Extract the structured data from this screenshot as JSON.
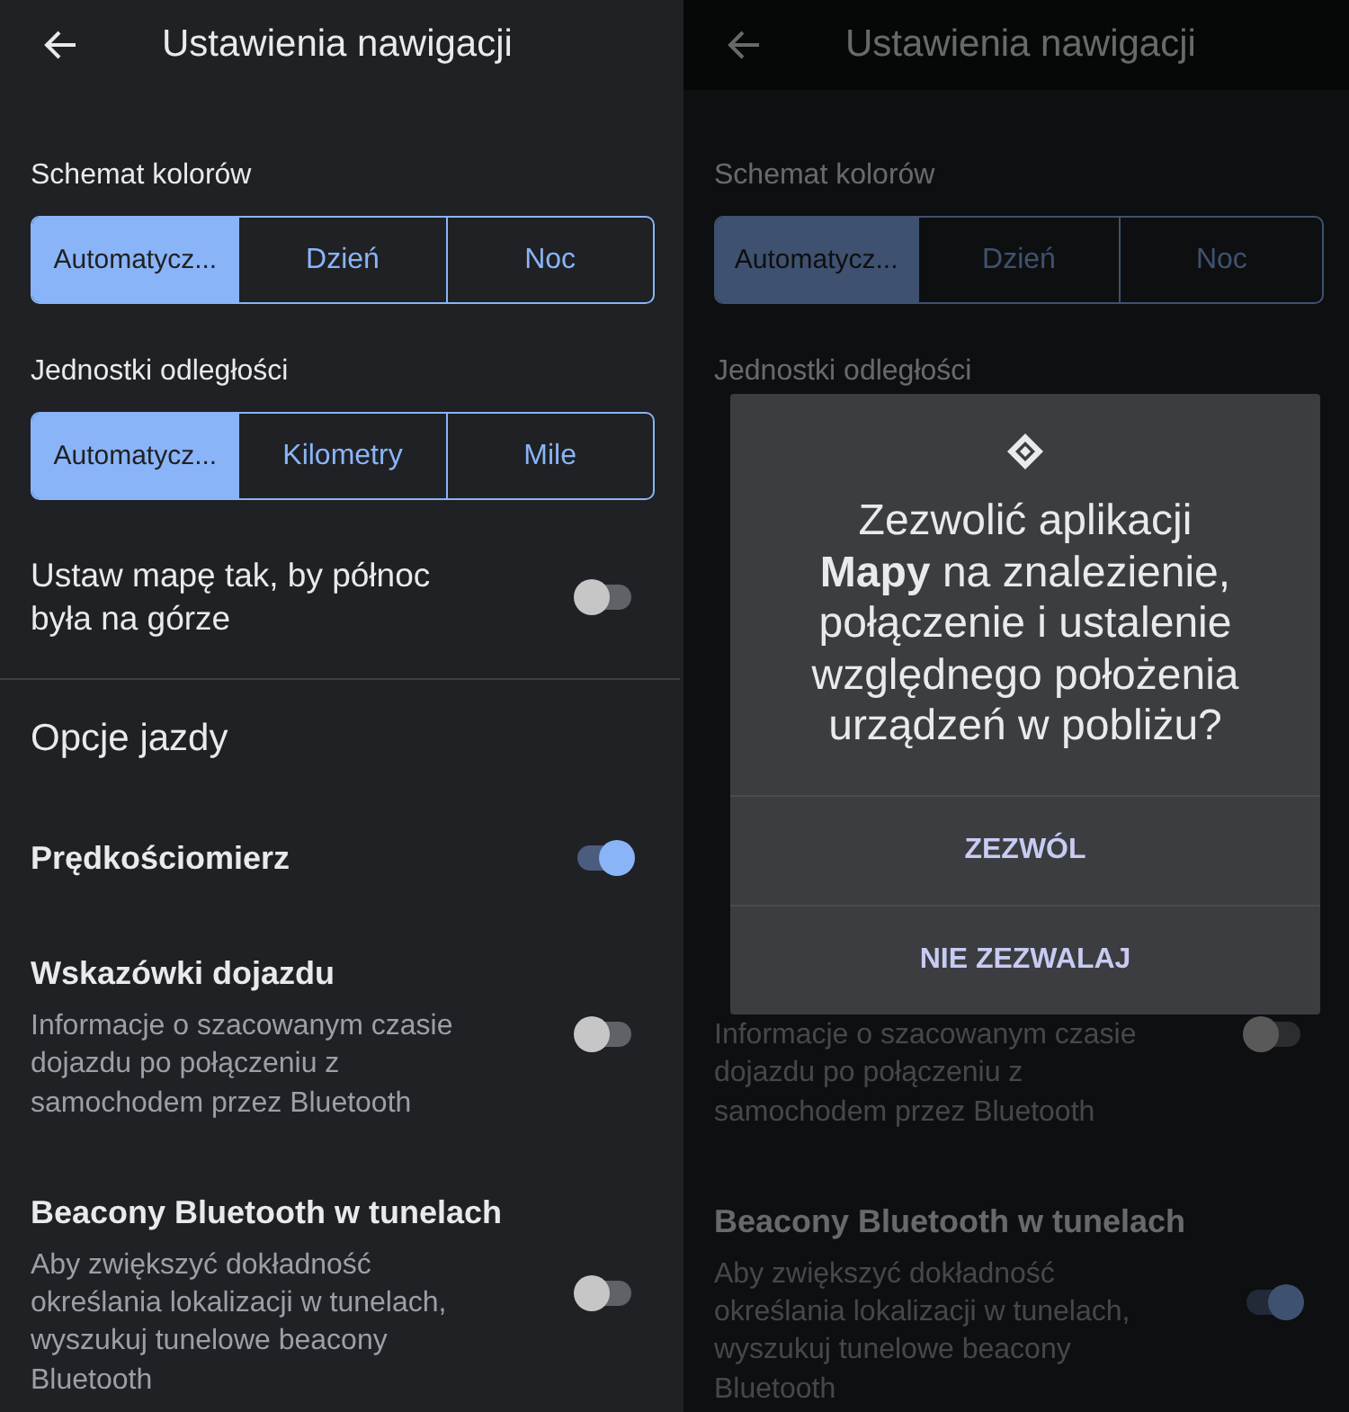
{
  "panels": [
    {
      "dimmed": false,
      "header": {
        "title": "Ustawienia nawigacji"
      },
      "items": [
        {
          "kind": "label",
          "text": "Schemat kolorów"
        },
        {
          "kind": "segmented",
          "options": [
            {
              "label": "Automatycz...",
              "selected": true
            },
            {
              "label": "Dzień",
              "selected": false
            },
            {
              "label": "Noc",
              "selected": false
            }
          ]
        },
        {
          "kind": "label",
          "text": "Jednostki odległości"
        },
        {
          "kind": "segmented",
          "options": [
            {
              "label": "Automatycz...",
              "selected": true
            },
            {
              "label": "Kilometry",
              "selected": false
            },
            {
              "label": "Mile",
              "selected": false
            }
          ]
        },
        {
          "kind": "toggle",
          "title": "Ustaw mapę tak, by północ była na górze",
          "on": false
        },
        {
          "kind": "section",
          "text": "Opcje jazdy"
        },
        {
          "kind": "toggle",
          "title": "Prędkościomierz",
          "on": true
        },
        {
          "kind": "toggle",
          "title": "Wskazówki dojazdu",
          "description": "Informacje o szacowanym czasie dojazdu po połączeniu z samochodem przez Bluetooth",
          "on": false
        },
        {
          "kind": "toggle",
          "title": "Beacony Bluetooth w tunelach",
          "description": "Aby zwiększyć dokładność określania lokalizacji w tunelach, wyszukuj tunelowe beacony Bluetooth",
          "on": false
        }
      ]
    },
    {
      "dimmed": true,
      "header": {
        "title": "Ustawienia nawigacji"
      },
      "items": [
        {
          "kind": "label",
          "text": "Schemat kolorów"
        },
        {
          "kind": "segmented",
          "options": [
            {
              "label": "Automatycz...",
              "selected": true
            },
            {
              "label": "Dzień",
              "selected": false
            },
            {
              "label": "Noc",
              "selected": false
            }
          ]
        },
        {
          "kind": "label",
          "text": "Jednostki odległości"
        }
      ],
      "dialog": {
        "message": "Zezwolić aplikacji **Mapy** na znalezienie, połączenie i ustalenie względnego położenia urządzeń w pobliżu?",
        "buttons": [
          "ZEZWÓL",
          "NIE ZEZWALAJ"
        ]
      },
      "items_below": [
        {
          "kind": "toggle",
          "description": "Informacje o szacowanym czasie dojazdu po połączeniu z samochodem przez Bluetooth",
          "on": false
        },
        {
          "kind": "toggle",
          "title": "Beacony Bluetooth w tunelach",
          "description": "Aby zwiększyć dokładność określania lokalizacji w tunelach, wyszukuj tunelowe beacony Bluetooth",
          "on": true
        }
      ]
    }
  ]
}
